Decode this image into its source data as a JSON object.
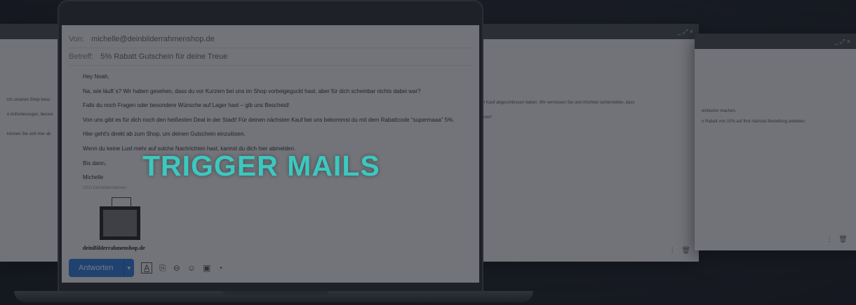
{
  "headline": "TRIGGER MAILS",
  "email": {
    "from_label": "Von:",
    "from_value": "michelle@deinbilderrahmenshop.de",
    "subject_label": "Betreff:",
    "subject_value": "5% Rabatt Gutschein für deine Treue",
    "lines": [
      "Hey Noah,",
      "Na, wie läuft´s? Wir haben gesehen, dass du vor Kurzem bei uns im Shop vorbeigeguckt hast, aber für dich scheinbar nichts dabei war?",
      "Falls du noch Fragen oder besondere Wünsche auf Lager hast – gib uns Bescheid!",
      "Von uns gibt es für dich noch den heißesten Deal in der Stadt! Für deinen nächsten Kauf bei uns bekommst du mit dem Rabattcode \"supermaaa\" 5%.",
      "Hier geht's direkt ab zum Shop, um deinen Gutschein einzulösen.",
      "Wenn du keine Lust mehr auf solche Nachrichten hast, kannst du dich hier abmelden.",
      "Bis dann,",
      "Michelle"
    ],
    "signature_role": "CEO Deinbilderrahmen",
    "logo_text": "deinBilderrahmenshop.de",
    "reply_label": "Antworten"
  },
  "bg_left": {
    "lines": [
      "ich unseren Shop besu",
      "e Anforderungen, besser",
      "können Sie sich hier ab"
    ]
  },
  "bg_right1": {
    "controls": "_ ⤢ ×",
    "lines": [
      "n Kauf abgeschlossen haben. Wir vermissen Sie und möchten sicherstellen, dass",
      "sser!"
    ]
  },
  "bg_right2": {
    "controls": "_ ⤢ ×",
    "lines": [
      "einfacher machen.",
      "n Rabatt von 10% auf Ihre nächste Bestellung anbieten."
    ]
  }
}
